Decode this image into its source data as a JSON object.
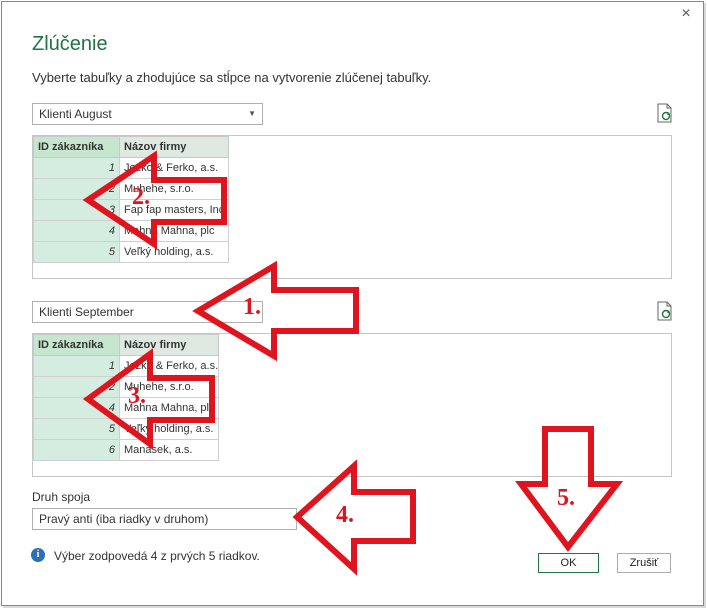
{
  "dialog": {
    "title": "Zlúčenie",
    "subtitle": "Vyberte tabuľky a zhodujúce sa stĺpce na vytvorenie zlúčenej tabuľky.",
    "close_icon": "×"
  },
  "table1": {
    "selected": "Klienti August",
    "headers": [
      "ID zákazníka",
      "Názov firmy"
    ],
    "rows": [
      {
        "id": "1",
        "name": "Jozko & Ferko, a.s."
      },
      {
        "id": "2",
        "name": "Muhehe, s.r.o."
      },
      {
        "id": "3",
        "name": "Fap fap masters, Inc."
      },
      {
        "id": "4",
        "name": "Mahna Mahna, plc"
      },
      {
        "id": "5",
        "name": "Veľký holding, a.s."
      }
    ]
  },
  "table2": {
    "selected": "Klienti September",
    "headers": [
      "ID zákazníka",
      "Názov firmy"
    ],
    "rows": [
      {
        "id": "1",
        "name": "Jozko & Ferko, a.s."
      },
      {
        "id": "2",
        "name": "Muhehe, s.r.o."
      },
      {
        "id": "4",
        "name": "Mahna Mahna, plc"
      },
      {
        "id": "5",
        "name": "Veľký holding, a.s."
      },
      {
        "id": "6",
        "name": "Manasek, a.s."
      }
    ]
  },
  "join": {
    "label": "Druh spoja",
    "selected": "Pravý anti (iba riadky v druhom)"
  },
  "info_text": "Výber zodpovedá 4 z prvých 5 riadkov.",
  "buttons": {
    "ok": "OK",
    "cancel": "Zrušiť"
  },
  "annotations": [
    "1.",
    "2.",
    "3.",
    "4.",
    "5."
  ],
  "colors": {
    "accent": "#217346",
    "annotation": "#e0141e",
    "id_column": "#d4ede0"
  },
  "icons": [
    "close-icon",
    "refresh-icon",
    "chevron-down-icon",
    "info-icon"
  ]
}
